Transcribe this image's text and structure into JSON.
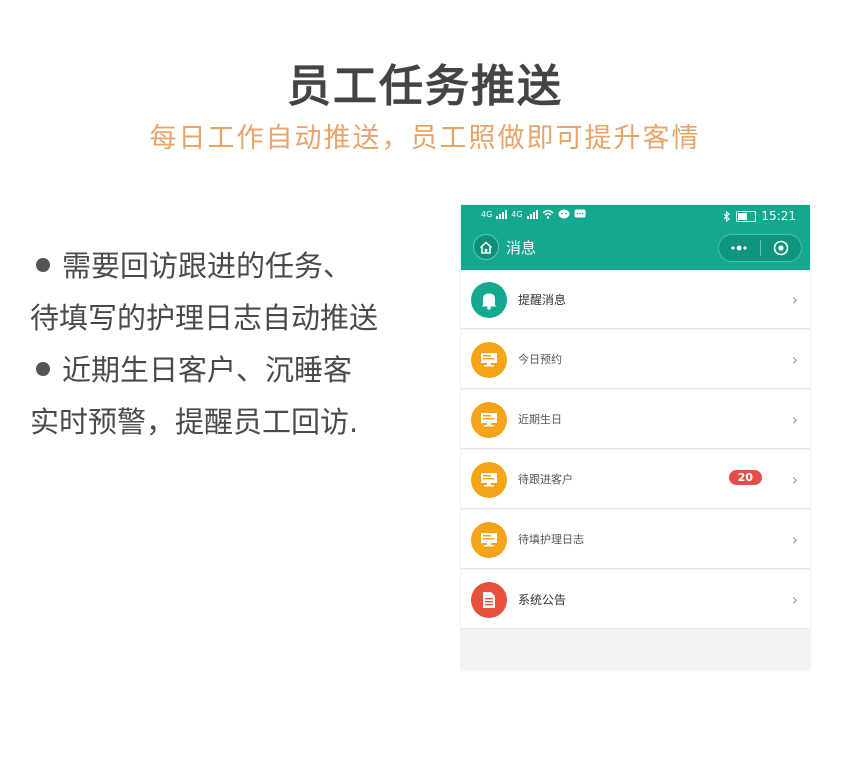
{
  "header": {
    "title": "员工任务推送",
    "subtitle": "每日工作自动推送，员工照做即可提升客情"
  },
  "description": {
    "lines": [
      "需要回访跟进的任务、",
      "待填写的护理日志自动推送",
      "近期生日客户、沉睡客",
      "实时预警，提醒员工回访."
    ]
  },
  "phone": {
    "status": {
      "network1": "4G",
      "network2": "4G",
      "time": "15:21"
    },
    "nav": {
      "title": "消息"
    },
    "list": [
      {
        "label": "提醒消息",
        "icon": "bell-icon",
        "color": "#14a88f"
      },
      {
        "label": "今日预约",
        "icon": "monitor-icon",
        "color": "#f5a317"
      },
      {
        "label": "近期生日",
        "icon": "monitor-icon",
        "color": "#f5a317"
      },
      {
        "label": "待跟进客户",
        "icon": "monitor-icon",
        "color": "#f5a317",
        "badge": "20"
      },
      {
        "label": "待填护理日志",
        "icon": "monitor-icon",
        "color": "#f5a317"
      },
      {
        "label": "系统公告",
        "icon": "document-icon",
        "color": "#e8503e"
      }
    ]
  }
}
